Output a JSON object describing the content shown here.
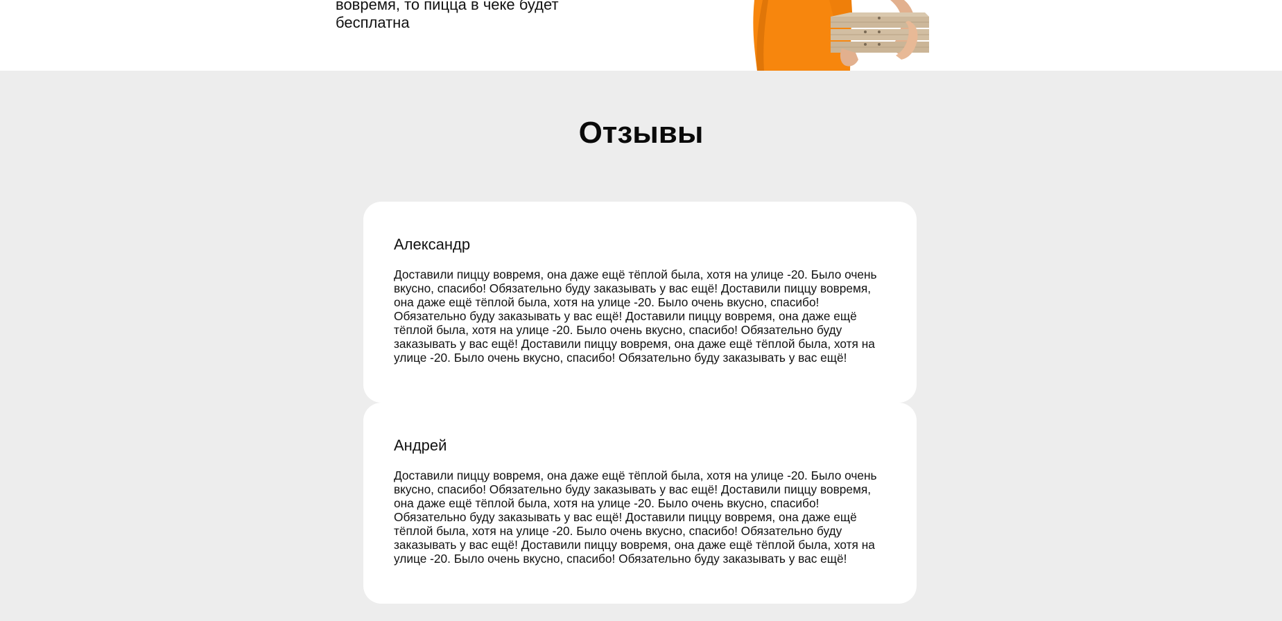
{
  "promo": {
    "text": "вовремя, то пицца в чеке будет бесплатна"
  },
  "colors": {
    "accent": "#f7860d",
    "section_bg": "#ededed",
    "card_bg": "#ffffff"
  },
  "reviews": {
    "title": "Отзывы",
    "items": [
      {
        "author": "Александр",
        "text": "Доставили пиццу вовремя, она даже ещё тёплой была, хотя на улице -20. Было очень вкусно, спасибо! Обязательно буду заказывать у вас ещё! Доставили пиццу вовремя, она даже ещё тёплой была, хотя на улице -20. Было очень вкусно, спасибо! Обязательно буду заказывать у вас ещё! Доставили пиццу вовремя, она даже ещё тёплой была, хотя на улице -20. Было очень вкусно, спасибо! Обязательно буду заказывать у вас ещё! Доставили пиццу вовремя, она даже ещё тёплой была, хотя на улице -20. Было очень вкусно, спасибо! Обязательно буду заказывать у вас ещё!"
      },
      {
        "author": "Андрей",
        "text": "Доставили пиццу вовремя, она даже ещё тёплой была, хотя на улице -20. Было очень вкусно, спасибо! Обязательно буду заказывать у вас ещё! Доставили пиццу вовремя, она даже ещё тёплой была, хотя на улице -20. Было очень вкусно, спасибо! Обязательно буду заказывать у вас ещё! Доставили пиццу вовремя, она даже ещё тёплой была, хотя на улице -20. Было очень вкусно, спасибо! Обязательно буду заказывать у вас ещё! Доставили пиццу вовремя, она даже ещё тёплой была, хотя на улице -20. Было очень вкусно, спасибо! Обязательно буду заказывать у вас ещё!"
      }
    ]
  }
}
